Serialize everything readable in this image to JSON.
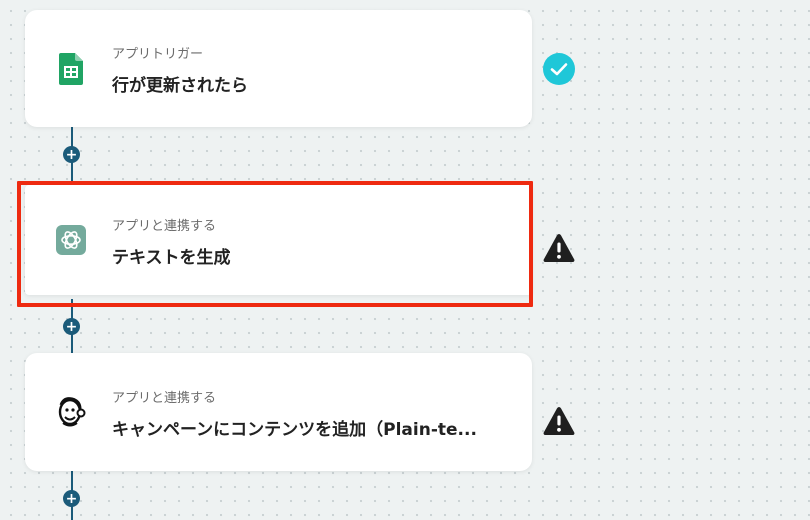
{
  "steps": [
    {
      "subtitle": "アプリトリガー",
      "title": "行が更新されたら",
      "icon": "google-sheets-icon",
      "status": "check-icon"
    },
    {
      "subtitle": "アプリと連携する",
      "title": "テキストを生成",
      "icon": "openai-chatgpt-icon",
      "status": "warning-icon"
    },
    {
      "subtitle": "アプリと連携する",
      "title": "キャンペーンにコンテンツを追加（Plain-te...",
      "icon": "mailchimp-icon",
      "status": "warning-icon"
    }
  ],
  "add_label": "+",
  "colors": {
    "accent": "#1b5b7a",
    "check": "#1fc7d8",
    "highlight": "#ee2a10",
    "warning": "#1f1f1f"
  }
}
